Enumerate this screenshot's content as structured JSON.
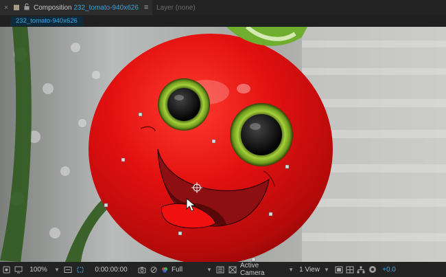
{
  "tabs": {
    "active": {
      "close": "×",
      "lock": "🔓",
      "prefix": "Composition",
      "comp_name": "232_tomato-940x626",
      "menu": "≡"
    },
    "inactive": {
      "label": "Layer (none)"
    }
  },
  "breadcrumb": {
    "label": "232_tomato-940x626"
  },
  "toolbar": {
    "zoom": "100%",
    "timecode": "0:00:00:00",
    "resolution": "Full",
    "camera": "Active Camera",
    "views": "1 View",
    "exposure": "+0.0"
  },
  "colors": {
    "accent": "#3aaae8",
    "tomato": "#d81313",
    "eye_ring": "#8fbf2a",
    "stem": "#6fae2e",
    "mouth": "#8e0f12",
    "tongue": "#f01010"
  },
  "icons": [
    "close-icon",
    "color-swatch-icon",
    "lock-icon",
    "panel-menu-icon",
    "always-preview-icon",
    "monitor-icon",
    "fit-icon",
    "region-icon",
    "transparency-grid-icon",
    "camera-snapshot-icon",
    "show-snapshot-icon",
    "color-channel-icon",
    "fast-preview-icon",
    "toggle-transparency-icon",
    "3d-view-icon",
    "flowchart-icon",
    "reset-exposure-icon"
  ]
}
